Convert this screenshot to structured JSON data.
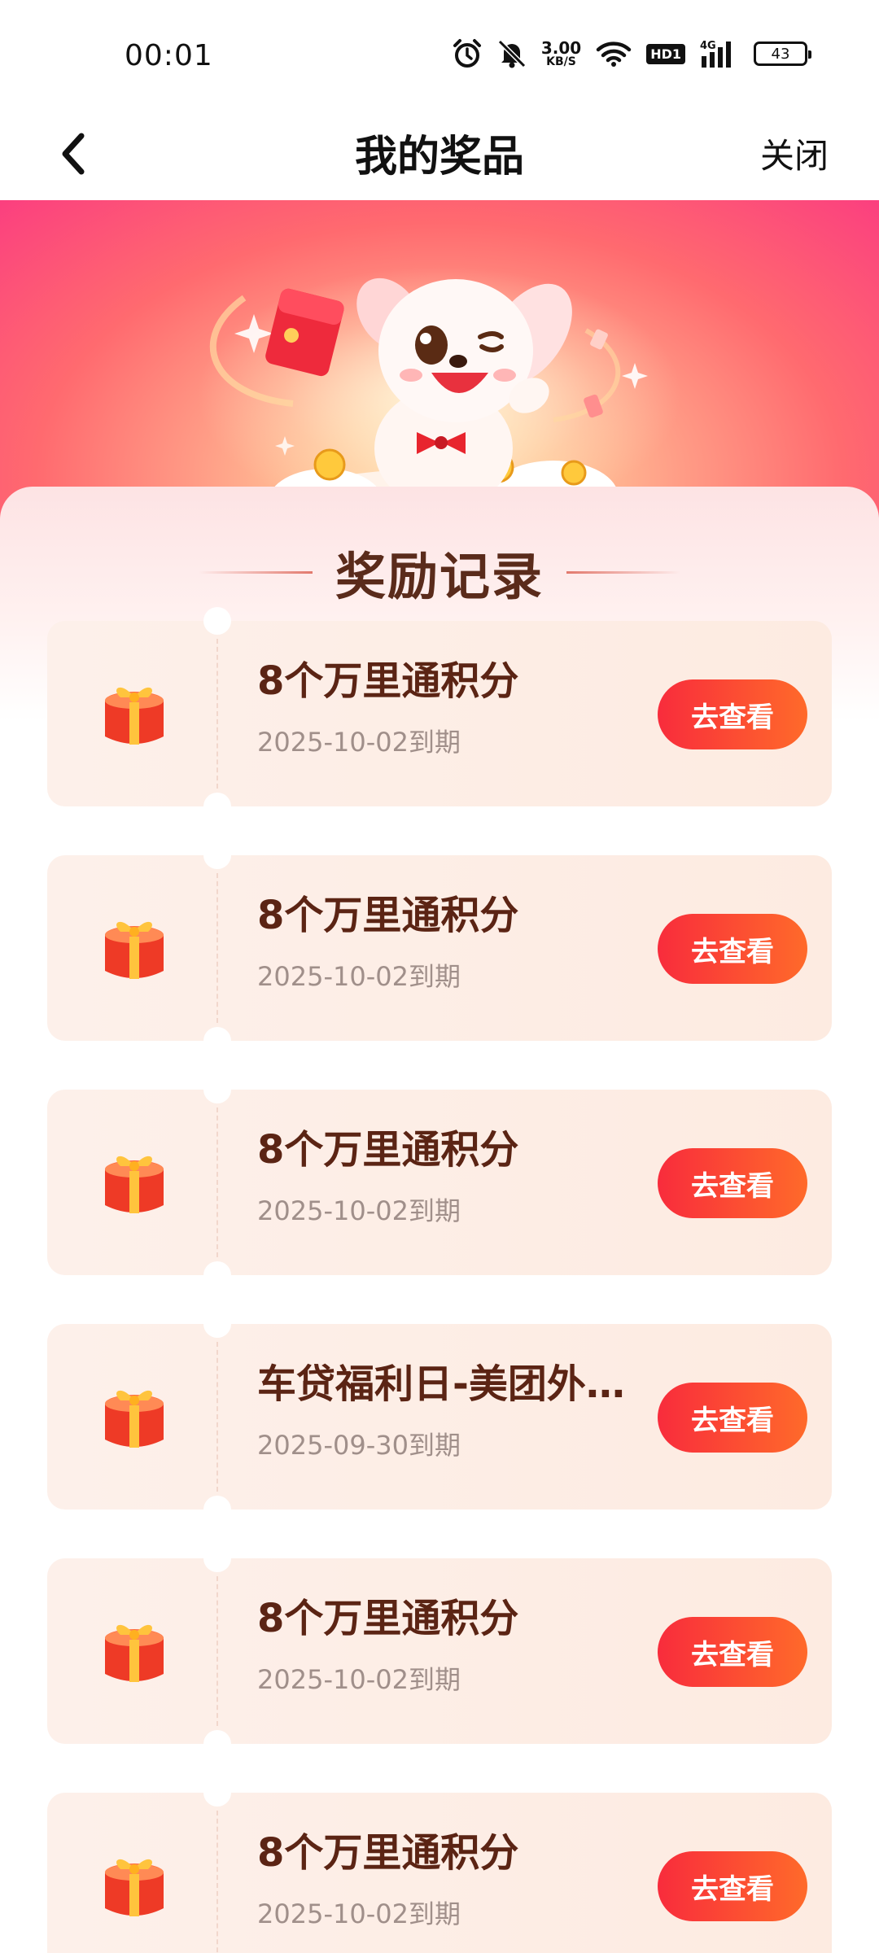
{
  "status_bar": {
    "time": "00:01",
    "net_speed_value": "3.00",
    "net_speed_unit": "KB/S",
    "hd_badge": "HD1",
    "signal_label": "4G",
    "battery_level": "43",
    "icons": [
      "alarm-icon",
      "mute-bell-icon",
      "wifi-icon",
      "hd-icon",
      "cell-signal-icon",
      "battery-icon"
    ]
  },
  "nav": {
    "title": "我的奖品",
    "close_label": "关闭",
    "back_icon": "chevron-left-icon"
  },
  "hero": {
    "illustration": "puppy-mascot-with-red-envelope"
  },
  "section": {
    "title": "奖励记录"
  },
  "rewards": [
    {
      "title": "8个万里通积分",
      "expiry": "2025-10-02到期",
      "button": "去查看",
      "icon": "gift-box-icon"
    },
    {
      "title": "8个万里通积分",
      "expiry": "2025-10-02到期",
      "button": "去查看",
      "icon": "gift-box-icon"
    },
    {
      "title": "8个万里通积分",
      "expiry": "2025-10-02到期",
      "button": "去查看",
      "icon": "gift-box-icon"
    },
    {
      "title": "车贷福利日-美团外…",
      "expiry": "2025-09-30到期",
      "button": "去查看",
      "icon": "gift-box-icon"
    },
    {
      "title": "8个万里通积分",
      "expiry": "2025-10-02到期",
      "button": "去查看",
      "icon": "gift-box-icon"
    },
    {
      "title": "8个万里通积分",
      "expiry": "2025-10-02到期",
      "button": "去查看",
      "icon": "gift-box-icon"
    }
  ],
  "colors": {
    "accent_red": "#f82c3c",
    "accent_orange": "#ff6a2a",
    "title_brown": "#5b2414",
    "card_bg": "#fdf0ea"
  }
}
